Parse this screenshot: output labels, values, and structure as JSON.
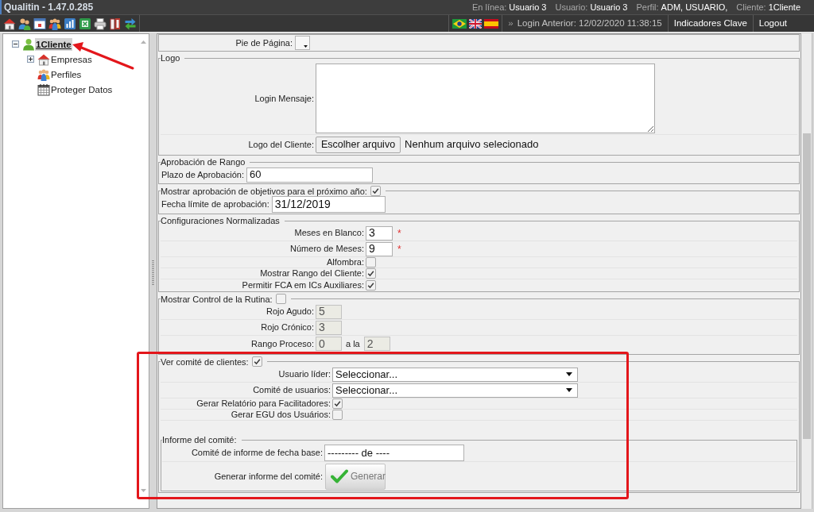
{
  "window": {
    "title": "Qualitin - 1.47.0.285"
  },
  "session": [
    {
      "label": "En línea:",
      "value": "Usuario 3"
    },
    {
      "label": "Usuario:",
      "value": "Usuario 3"
    },
    {
      "label": "Perfil:",
      "value": "ADM, USUARIO,"
    },
    {
      "label": "Cliente:",
      "value": "1Cliente"
    }
  ],
  "header": {
    "last_login": {
      "marker": "»",
      "text": "Login Anterior: 12/02/2020 11:38:15"
    },
    "links": [
      "Indicadores Clave",
      "Logout"
    ]
  },
  "tree": [
    {
      "label": "1Cliente",
      "kind": "client",
      "selected": true,
      "expanded": true,
      "children": [
        {
          "label": "Empresas",
          "kind": "company",
          "selected": false,
          "expanded": false
        },
        {
          "label": "Perfiles",
          "kind": "profile",
          "selected": false
        },
        {
          "label": "Proteger Datos",
          "kind": "calendar",
          "selected": false
        }
      ]
    }
  ],
  "form": {
    "sections": [
      {
        "kind": "plain",
        "rows": [
          {
            "kind": "picker",
            "label": "Pie de Página:"
          }
        ]
      },
      {
        "kind": "group",
        "legend": "Logo",
        "rows": [
          {
            "kind": "textarea",
            "label": "Login Mensaje:"
          },
          {
            "kind": "file",
            "label": "Logo del Cliente:",
            "button": "Escolher arquivo",
            "status": "Nenhum arquivo selecionado"
          }
        ]
      },
      {
        "kind": "inline",
        "legend": "Aprobación de Rango",
        "rows": [
          {
            "kind": "text",
            "label": "Plazo de Aprobación:",
            "value": "60",
            "disabled": false
          }
        ]
      },
      {
        "kind": "inline",
        "legend": "Mostrar aprobación de objetivos para el próximo año:",
        "checked": true,
        "rows": [
          {
            "kind": "text",
            "label": "Fecha límite de aprobación:",
            "value": "31/12/2019",
            "disabled": false
          }
        ]
      },
      {
        "kind": "group",
        "legend": "Configuraciones Normalizadas",
        "rows": [
          {
            "kind": "text",
            "label": "Meses en Blanco:",
            "value": "3",
            "disabled": false,
            "mark": "*"
          },
          {
            "kind": "text",
            "label": "Número de Meses:",
            "value": "9",
            "disabled": false,
            "mark": "*"
          },
          {
            "kind": "checkbox",
            "label": "Alfombra:",
            "checked": false
          },
          {
            "kind": "checkbox",
            "label": "Mostrar Rango del Cliente:",
            "checked": true
          },
          {
            "kind": "checkbox",
            "label": "Permitir FCA em ICs Auxiliares:",
            "checked": true
          }
        ]
      },
      {
        "kind": "group",
        "legend": "Mostrar Control de la Rutina:",
        "checked": false,
        "rows": [
          {
            "kind": "text",
            "label": "Rojo Agudo:",
            "value": "5",
            "disabled": true
          },
          {
            "kind": "text",
            "label": "Rojo Crónico:",
            "value": "3",
            "disabled": true
          },
          {
            "kind": "range",
            "label": "Rango Proceso:",
            "value": "0",
            "joiner": "a la",
            "value_to": "2",
            "disabled": true
          }
        ]
      },
      {
        "kind": "group",
        "legend": "Ver comité de clientes:",
        "checked": true,
        "rows": [
          {
            "kind": "select",
            "label": "Usuario líder:",
            "value": "Seleccionar..."
          },
          {
            "kind": "select",
            "label": "Comité de usuarios:",
            "value": "Seleccionar..."
          },
          {
            "kind": "checkbox",
            "label": "Gerar Relatório para Facilitadores:",
            "checked": true
          },
          {
            "kind": "checkbox",
            "label": "Gerar EGU dos Usuários:",
            "checked": false
          }
        ],
        "subsection": {
          "legend": "Informe del comité:",
          "rows": [
            {
              "kind": "text",
              "label": "Comité de informe de fecha base:",
              "value": "--------- de ----",
              "disabled": false
            },
            {
              "kind": "button",
              "label": "Generar informe del comité:",
              "button": "Generar"
            }
          ]
        }
      }
    ]
  }
}
